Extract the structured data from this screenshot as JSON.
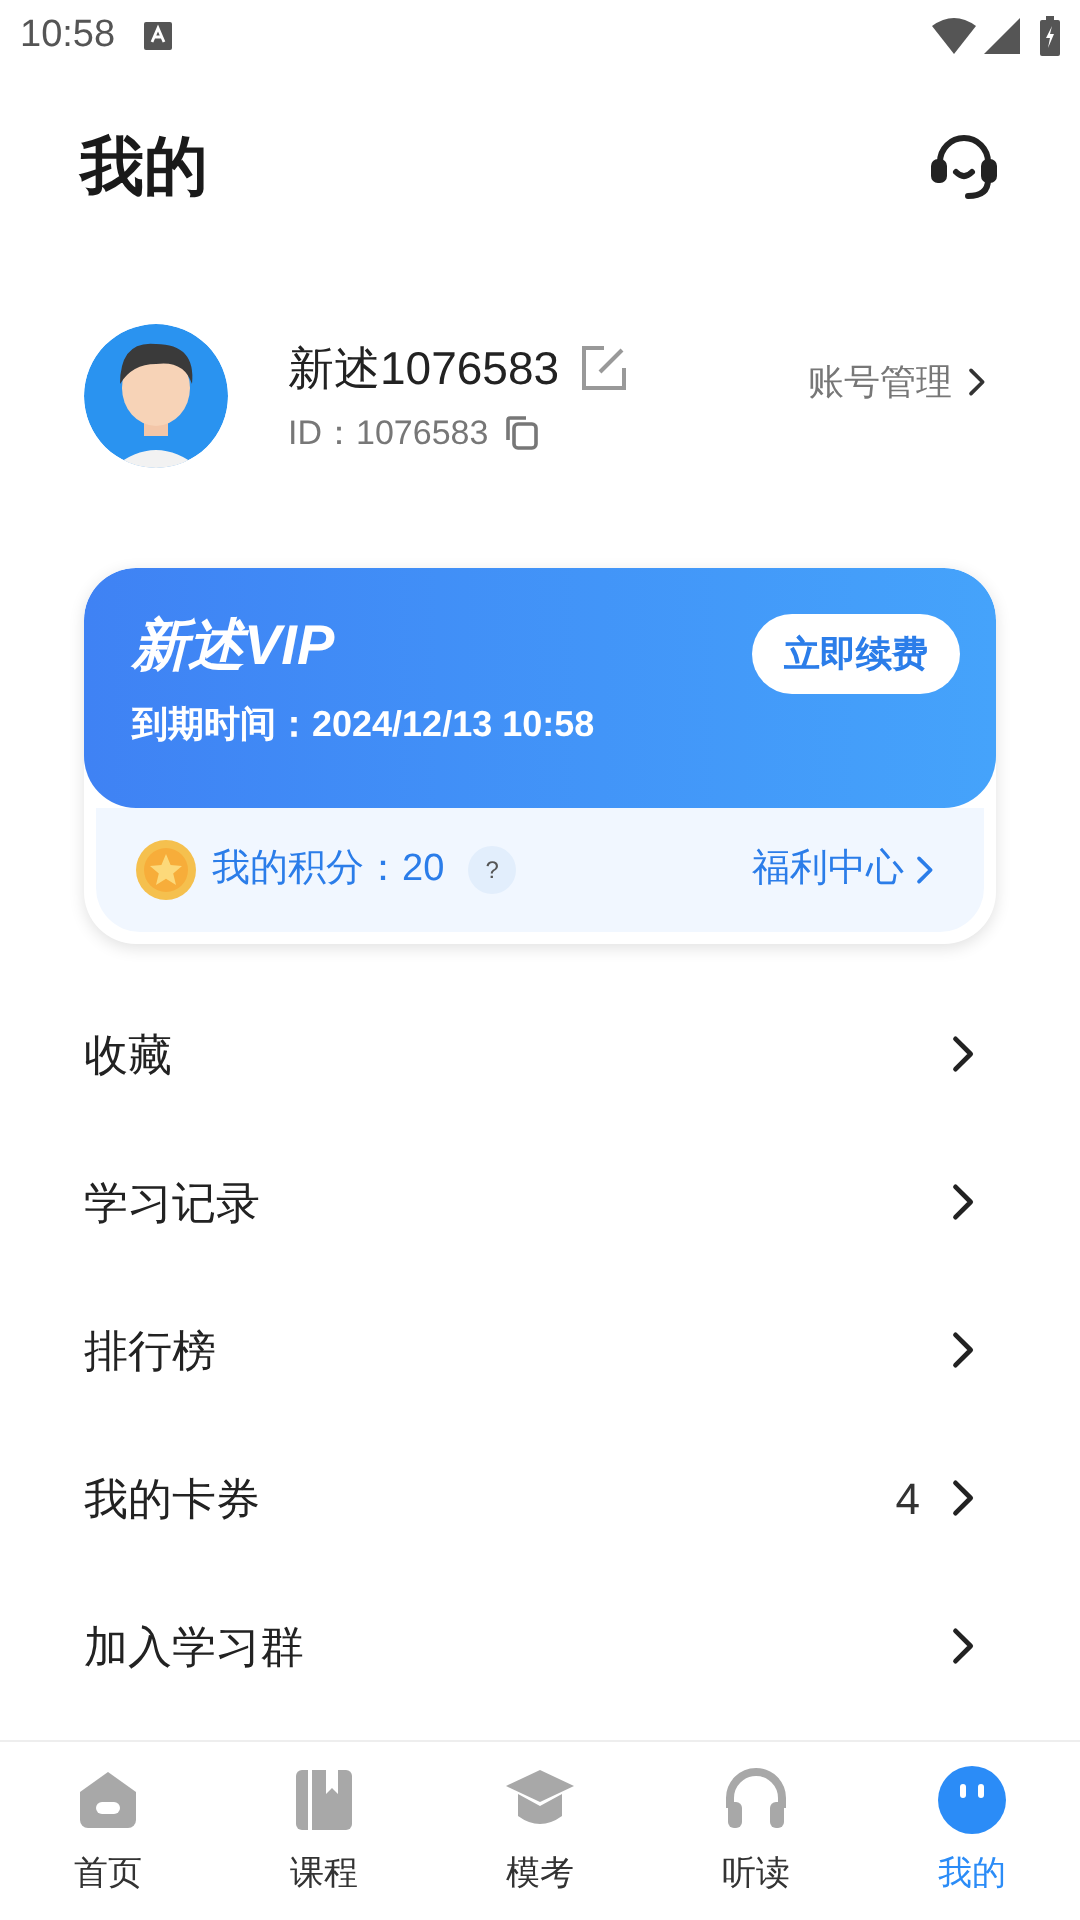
{
  "status_bar": {
    "time": "10:58"
  },
  "header": {
    "title": "我的"
  },
  "profile": {
    "name": "新述1076583",
    "id": "ID：1076583",
    "account_link": "账号管理"
  },
  "vip_card": {
    "title": "新述VIP",
    "renew_button": "立即续费",
    "expiry": "到期时间：2024/12/13 10:58",
    "points": "我的积分：20",
    "help": "?",
    "welfare_link": "福利中心"
  },
  "menu": [
    {
      "label": "收藏"
    },
    {
      "label": "学习记录"
    },
    {
      "label": "排行榜"
    },
    {
      "label": "我的卡券",
      "count": "4"
    },
    {
      "label": "加入学习群"
    }
  ],
  "bottom_nav": [
    {
      "label": "首页",
      "kind": "home",
      "selected": false
    },
    {
      "label": "课程",
      "kind": "book",
      "selected": false
    },
    {
      "label": "模考",
      "kind": "cap",
      "selected": false
    },
    {
      "label": "听读",
      "kind": "headphones",
      "selected": false
    },
    {
      "label": "我的",
      "kind": "face",
      "selected": true
    }
  ]
}
